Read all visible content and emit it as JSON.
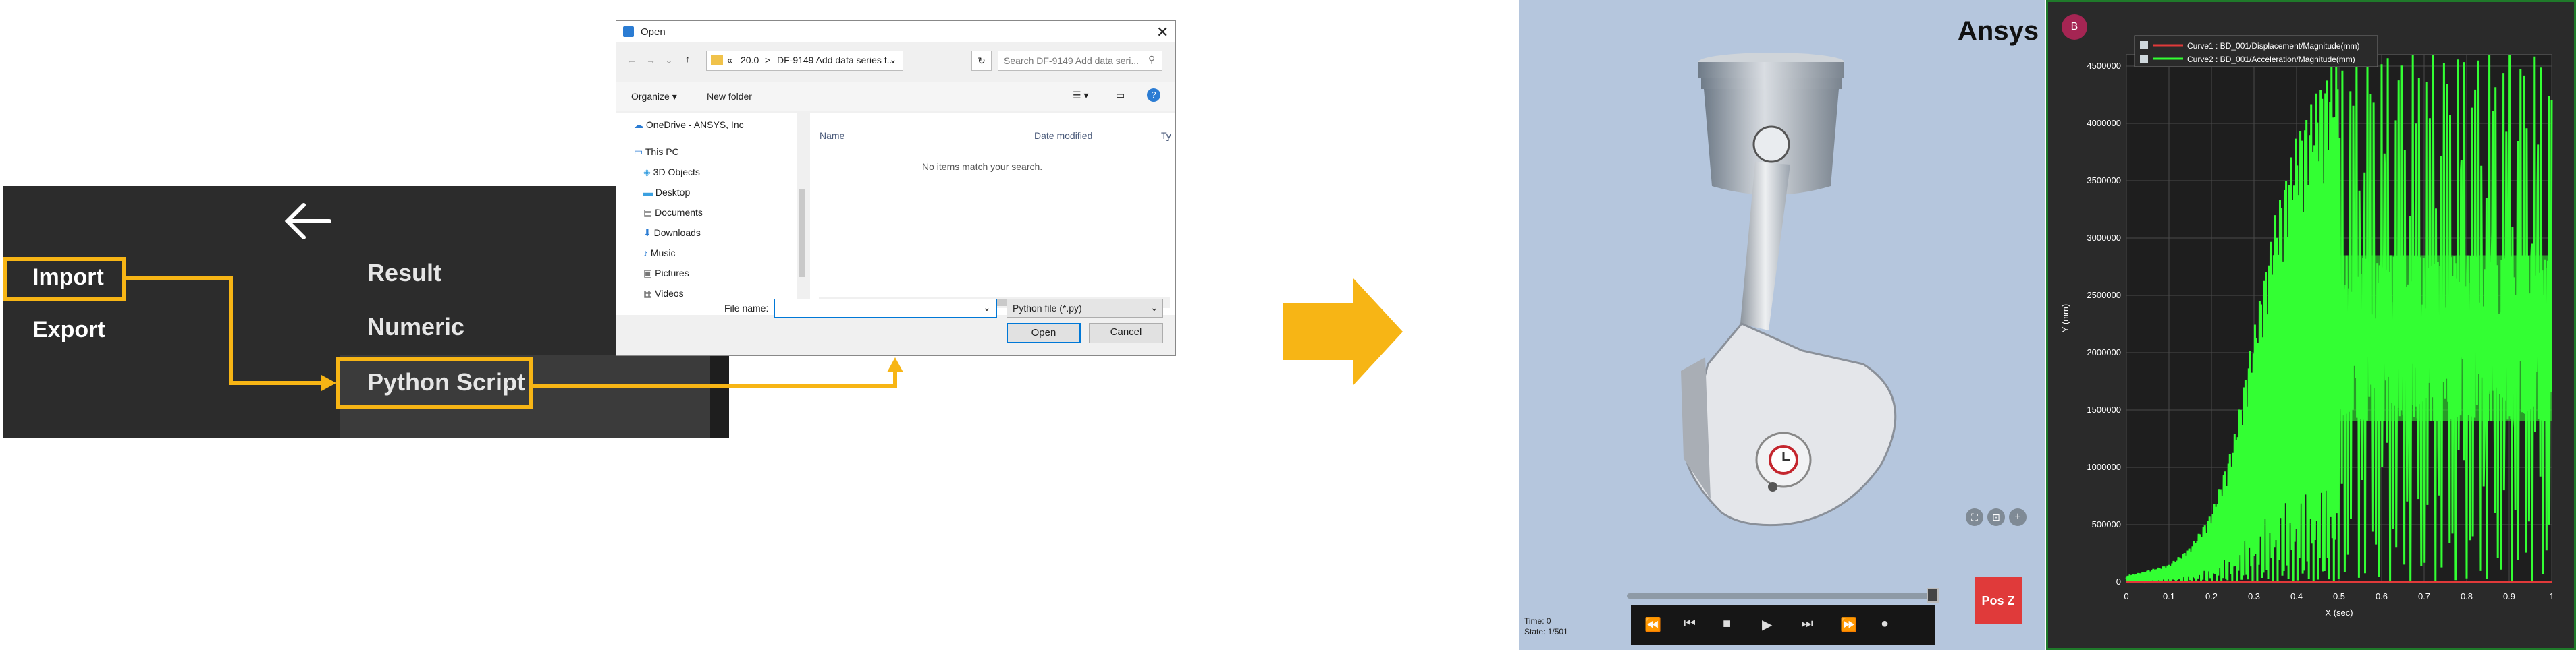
{
  "menu": {
    "items": [
      {
        "label": "Import"
      },
      {
        "label": "Export"
      }
    ],
    "submenu": [
      {
        "label": "Result"
      },
      {
        "label": "Numeric"
      },
      {
        "label": "Python Script"
      }
    ]
  },
  "dialog": {
    "title": "Open",
    "breadcrumb": {
      "prefix": "«",
      "seg1": "20.0",
      "sep": ">",
      "seg2": "DF-9149 Add data series f..."
    },
    "search_placeholder": "Search DF-9149 Add data seri...",
    "toolbar": {
      "organize": "Organize ▾",
      "new_folder": "New folder"
    },
    "nav_items": [
      {
        "label": "OneDrive - ANSYS, Inc"
      },
      {
        "label": "This PC"
      },
      {
        "label": "3D Objects"
      },
      {
        "label": "Desktop"
      },
      {
        "label": "Documents"
      },
      {
        "label": "Downloads"
      },
      {
        "label": "Music"
      },
      {
        "label": "Pictures"
      },
      {
        "label": "Videos"
      }
    ],
    "columns": {
      "name": "Name",
      "date": "Date modified",
      "type": "Ty"
    },
    "empty": "No items match your search.",
    "filename_label": "File name:",
    "filename_value": "",
    "filter": "Python file (*.py)",
    "open": "Open",
    "cancel": "Cancel"
  },
  "viewer": {
    "logo": "Ansys",
    "time_label": "Time: 0",
    "state_label": "State: 1/501",
    "view_label": "Pos Z"
  },
  "plot": {
    "badge": "B",
    "colors": {
      "curve1": "#e03a3a",
      "curve2": "#33ff33",
      "border": "#1f7a2a"
    },
    "chart_data": {
      "type": "line",
      "xlabel": "X (sec)",
      "ylabel": "Y (mm)",
      "xlim": [
        0,
        1
      ],
      "ylim": [
        0,
        4600000
      ],
      "xticks": [
        "0",
        "0.1",
        "0.2",
        "0.3",
        "0.4",
        "0.5",
        "0.6",
        "0.7",
        "0.8",
        "0.9",
        "1"
      ],
      "yticks": [
        "0",
        "500000",
        "1000000",
        "1500000",
        "2000000",
        "2500000",
        "3000000",
        "3500000",
        "4000000",
        "4500000"
      ],
      "legend_position": "top-left",
      "series": [
        {
          "name": "Curve1 : BD_001/Displacement/Magnitude(mm)",
          "x": [
            0,
            1
          ],
          "y": [
            0,
            0
          ]
        },
        {
          "name": "Curve2 : BD_001/Acceleration/Magnitude(mm)",
          "envelope": {
            "x": [
              0,
              0.1,
              0.15,
              0.2,
              0.25,
              0.3,
              0.35,
              0.4,
              0.45,
              0.5,
              1
            ],
            "low": [
              0,
              0,
              0,
              0,
              0,
              0,
              0,
              0,
              0,
              0,
              0
            ],
            "high": [
              50000,
              150000,
              300000,
              600000,
              1200000,
              2200000,
              3200000,
              3900000,
              4300000,
              4600000,
              4600000
            ]
          },
          "band": {
            "x": [
              0.5,
              1
            ],
            "low": [
              1400000,
              1400000
            ],
            "high": [
              2850000,
              2850000
            ]
          }
        }
      ]
    }
  }
}
